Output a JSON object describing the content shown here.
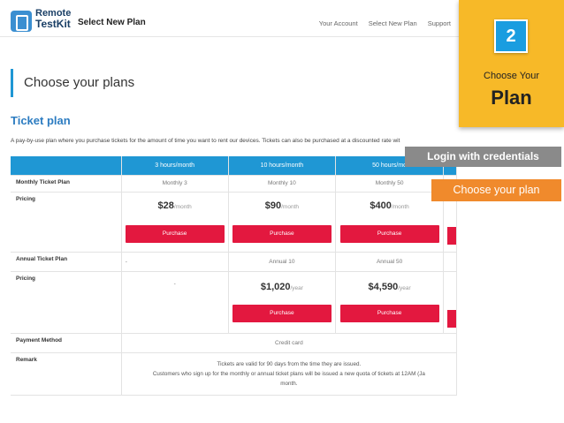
{
  "header": {
    "logo_line1": "Remote",
    "logo_line2": "TestKit",
    "page_title": "Select New Plan",
    "nav": [
      "Your Account",
      "Select New Plan",
      "Support"
    ]
  },
  "main": {
    "heading": "Choose your plans",
    "section_title": "Ticket plan",
    "description": "A pay-by-use plan where you purchase tickets for the amount of time you want to rent our devices. Tickets can also be purchased at a discounted rate wit",
    "columns": [
      "3 hours/month",
      "10 hours/month",
      "50 hours/mo"
    ],
    "monthly": {
      "label": "Monthly Ticket Plan",
      "names": [
        "Monthly 3",
        "Monthly 10",
        "Monthly 50"
      ]
    },
    "monthly_pricing": {
      "label": "Pricing",
      "prices": [
        "$28",
        "$90",
        "$400"
      ],
      "per": "/month"
    },
    "annual": {
      "label": "Annual Ticket Plan",
      "names": [
        "-",
        "Annual 10",
        "Annual 50"
      ]
    },
    "annual_pricing": {
      "label": "Pricing",
      "prices": [
        "-",
        "$1,020",
        "$4,590"
      ],
      "per": "/year"
    },
    "purchase_label": "Purchase",
    "payment": {
      "label": "Payment Method",
      "value": "Credit card"
    },
    "remark": {
      "label": "Remark",
      "line1": "Tickets are valid for 90 days from the time they are issued.",
      "line2": "Customers who sign up for the monthly or annual ticket plans will be issued a new quota of tickets at 12AM (Ja",
      "line3": "month."
    }
  },
  "overlay": {
    "step_number": "2",
    "step_sub": "Choose Your",
    "step_main": "Plan",
    "login_tag": "Login with credentials",
    "choose_tag": "Choose your plan",
    "colors": {
      "step_bg": "#f7b928",
      "step_num_bg": "#1a9de0",
      "login_bg": "#8a8a8a",
      "choose_bg": "#f08a2c",
      "purchase": "#e3183f",
      "table_header": "#1f97d4"
    }
  }
}
